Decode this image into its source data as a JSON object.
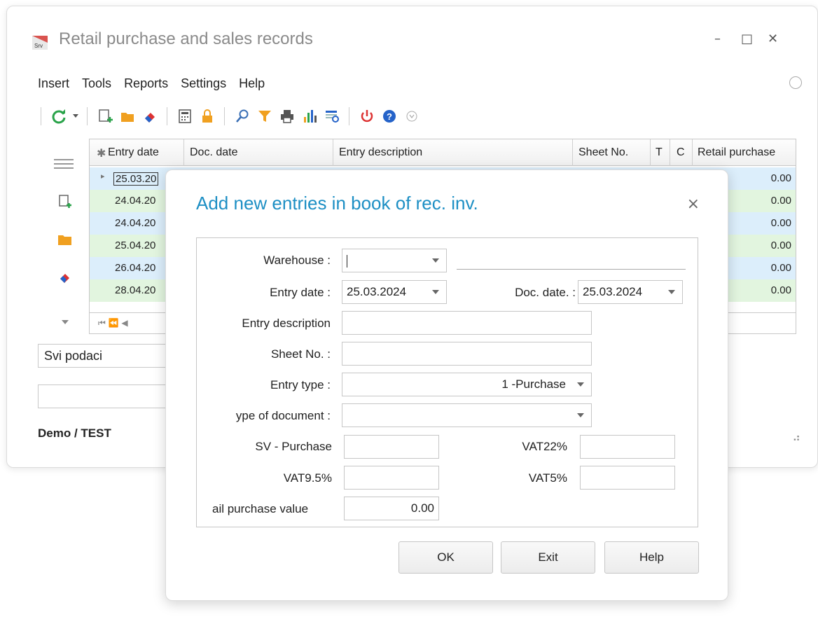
{
  "window": {
    "title": "Retail purchase and sales records",
    "minimize": "–",
    "maximize": "□",
    "close": "✕"
  },
  "menu": {
    "items": [
      "Insert",
      "Tools",
      "Reports",
      "Settings",
      "Help"
    ]
  },
  "grid": {
    "columns": [
      "Entry date",
      "Doc. date",
      "Entry description",
      "Sheet No.",
      "T",
      "C",
      "Retail purchase"
    ],
    "rows": [
      {
        "entry_date": "25.03.20",
        "value": "0.00",
        "color": "#dceefb"
      },
      {
        "entry_date": "24.04.20",
        "value": "0.00",
        "color": "#e2f5df"
      },
      {
        "entry_date": "24.04.20",
        "value": "0.00",
        "color": "#dceefb"
      },
      {
        "entry_date": "25.04.20",
        "value": "0.00",
        "color": "#e2f5df"
      },
      {
        "entry_date": "26.04.20",
        "value": "0.00",
        "color": "#dceefb"
      },
      {
        "entry_date": "28.04.20",
        "value": "0.00",
        "color": "#e2f5df"
      }
    ],
    "nav": "⏮ ⏪ ◀"
  },
  "filters": {
    "filter1_value": "Svi podaci"
  },
  "status": {
    "left": "Demo / TEST"
  },
  "dialog": {
    "title": "Add new entries in book of rec. inv.",
    "close": "×",
    "fields": {
      "warehouse_label": "Warehouse :",
      "warehouse_value": "",
      "entry_date_label": "Entry date :",
      "entry_date_value": "25.03.2024",
      "doc_date_label": "Doc. date. :",
      "doc_date_value": "25.03.2024",
      "entry_description_label": "Entry description",
      "sheet_no_label": "Sheet No. :",
      "entry_type_label": "Entry type :",
      "entry_type_value": "1 -Purchase",
      "type_of_document_label": "ype of document :",
      "sv_purchase_label": "SV - Purchase",
      "vat22_label": "VAT22%",
      "vat95_label": "VAT9.5%",
      "vat5_label": "VAT5%",
      "retail_purchase_value_label": "ail purchase value",
      "retail_purchase_value": "0.00"
    },
    "buttons": {
      "ok": "OK",
      "exit": "Exit",
      "help": "Help"
    }
  },
  "colors": {
    "accent": "#1d8fc4",
    "row_blue": "#dceefb",
    "row_green": "#e2f5df"
  }
}
